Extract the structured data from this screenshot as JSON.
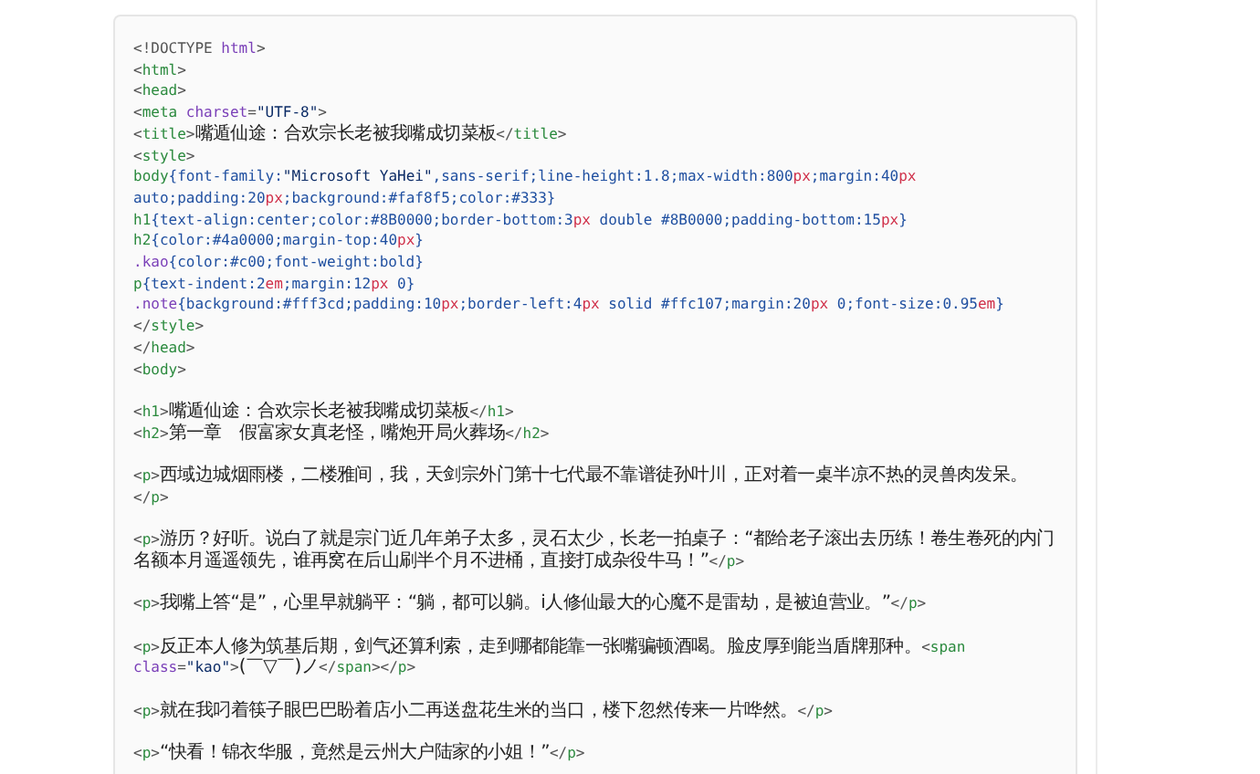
{
  "code_block": {
    "lines": [
      {
        "tokens": [
          {
            "kind": "p",
            "text": "<!DOCTYPE "
          },
          {
            "kind": "attr",
            "text": "html"
          },
          {
            "kind": "p",
            "text": ">"
          }
        ]
      },
      {
        "tokens": [
          {
            "kind": "p",
            "text": "<"
          },
          {
            "kind": "tag",
            "text": "html"
          },
          {
            "kind": "p",
            "text": ">"
          }
        ]
      },
      {
        "tokens": [
          {
            "kind": "p",
            "text": "<"
          },
          {
            "kind": "tag",
            "text": "head"
          },
          {
            "kind": "p",
            "text": ">"
          }
        ]
      },
      {
        "tokens": [
          {
            "kind": "p",
            "text": "<"
          },
          {
            "kind": "tag",
            "text": "meta"
          },
          {
            "kind": "attr",
            "text": " charset"
          },
          {
            "kind": "p",
            "text": "="
          },
          {
            "kind": "str",
            "text": "\"UTF-8\""
          },
          {
            "kind": "p",
            "text": ">"
          }
        ]
      },
      {
        "tokens": [
          {
            "kind": "p",
            "text": "<"
          },
          {
            "kind": "tag",
            "text": "title"
          },
          {
            "kind": "p",
            "text": ">"
          },
          {
            "kind": "cjk",
            "text": "嘴遁仙途：合欢宗长老被我嘴成切菜板"
          },
          {
            "kind": "p",
            "text": "</"
          },
          {
            "kind": "tag",
            "text": "title"
          },
          {
            "kind": "p",
            "text": ">"
          }
        ]
      },
      {
        "tokens": [
          {
            "kind": "p",
            "text": "<"
          },
          {
            "kind": "tag",
            "text": "style"
          },
          {
            "kind": "p",
            "text": ">"
          }
        ]
      },
      {
        "tokens": [
          {
            "kind": "sel",
            "text": "body"
          },
          {
            "kind": "prop",
            "text": "{font-family:"
          },
          {
            "kind": "str",
            "text": "\"Microsoft YaHei\""
          },
          {
            "kind": "prop",
            "text": ",sans-serif;line-height:"
          },
          {
            "kind": "num",
            "text": "1.8"
          },
          {
            "kind": "prop",
            "text": ";max-width:"
          },
          {
            "kind": "num",
            "text": "800"
          },
          {
            "kind": "unit",
            "text": "px"
          },
          {
            "kind": "prop",
            "text": ";margin:"
          },
          {
            "kind": "num",
            "text": "40"
          },
          {
            "kind": "unit",
            "text": "px"
          },
          {
            "kind": "prop",
            "text": " auto;padding:"
          },
          {
            "kind": "num",
            "text": "20"
          },
          {
            "kind": "unit",
            "text": "px"
          },
          {
            "kind": "prop",
            "text": ";background:#faf8f5;color:#333}"
          }
        ]
      },
      {
        "tokens": [
          {
            "kind": "sel",
            "text": "h1"
          },
          {
            "kind": "prop",
            "text": "{text-align:center;color:#8B0000;border-bottom:"
          },
          {
            "kind": "num",
            "text": "3"
          },
          {
            "kind": "unit",
            "text": "px"
          },
          {
            "kind": "prop",
            "text": " double #8B0000;padding-bottom:"
          },
          {
            "kind": "num",
            "text": "15"
          },
          {
            "kind": "unit",
            "text": "px"
          },
          {
            "kind": "prop",
            "text": "}"
          }
        ]
      },
      {
        "tokens": [
          {
            "kind": "sel",
            "text": "h2"
          },
          {
            "kind": "prop",
            "text": "{color:#4a0000;margin-top:"
          },
          {
            "kind": "num",
            "text": "40"
          },
          {
            "kind": "unit",
            "text": "px"
          },
          {
            "kind": "prop",
            "text": "}"
          }
        ]
      },
      {
        "tokens": [
          {
            "kind": "cls",
            "text": ".kao"
          },
          {
            "kind": "prop",
            "text": "{color:#c00;font-weight:bold}"
          }
        ]
      },
      {
        "tokens": [
          {
            "kind": "sel",
            "text": "p"
          },
          {
            "kind": "prop",
            "text": "{text-indent:"
          },
          {
            "kind": "num",
            "text": "2"
          },
          {
            "kind": "unit",
            "text": "em"
          },
          {
            "kind": "prop",
            "text": ";margin:"
          },
          {
            "kind": "num",
            "text": "12"
          },
          {
            "kind": "unit",
            "text": "px"
          },
          {
            "kind": "prop",
            "text": " 0}"
          }
        ]
      },
      {
        "tokens": [
          {
            "kind": "cls",
            "text": ".note"
          },
          {
            "kind": "prop",
            "text": "{background:#fff3cd;padding:"
          },
          {
            "kind": "num",
            "text": "10"
          },
          {
            "kind": "unit",
            "text": "px"
          },
          {
            "kind": "prop",
            "text": ";border-left:"
          },
          {
            "kind": "num",
            "text": "4"
          },
          {
            "kind": "unit",
            "text": "px"
          },
          {
            "kind": "prop",
            "text": " solid #ffc107;margin:"
          },
          {
            "kind": "num",
            "text": "20"
          },
          {
            "kind": "unit",
            "text": "px"
          },
          {
            "kind": "prop",
            "text": " 0;font-size:"
          },
          {
            "kind": "num",
            "text": "0.95"
          },
          {
            "kind": "unit",
            "text": "em"
          },
          {
            "kind": "prop",
            "text": "}"
          }
        ]
      },
      {
        "tokens": [
          {
            "kind": "p",
            "text": "</"
          },
          {
            "kind": "tag",
            "text": "style"
          },
          {
            "kind": "p",
            "text": ">"
          }
        ]
      },
      {
        "tokens": [
          {
            "kind": "p",
            "text": "</"
          },
          {
            "kind": "tag",
            "text": "head"
          },
          {
            "kind": "p",
            "text": ">"
          }
        ]
      },
      {
        "tokens": [
          {
            "kind": "p",
            "text": "<"
          },
          {
            "kind": "tag",
            "text": "body"
          },
          {
            "kind": "p",
            "text": ">"
          }
        ]
      },
      {
        "gap_before": true,
        "tokens": [
          {
            "kind": "p",
            "text": "<"
          },
          {
            "kind": "tag",
            "text": "h1"
          },
          {
            "kind": "p",
            "text": ">"
          },
          {
            "kind": "cjk",
            "text": "嘴遁仙途：合欢宗长老被我嘴成切菜板"
          },
          {
            "kind": "p",
            "text": "</"
          },
          {
            "kind": "tag",
            "text": "h1"
          },
          {
            "kind": "p",
            "text": ">"
          }
        ]
      },
      {
        "tokens": [
          {
            "kind": "p",
            "text": "<"
          },
          {
            "kind": "tag",
            "text": "h2"
          },
          {
            "kind": "p",
            "text": ">"
          },
          {
            "kind": "cjk",
            "text": "第一章　假富家女真老怪，嘴炮开局火葬场"
          },
          {
            "kind": "p",
            "text": "</"
          },
          {
            "kind": "tag",
            "text": "h2"
          },
          {
            "kind": "p",
            "text": ">"
          }
        ]
      },
      {
        "gap_before": true,
        "tokens": [
          {
            "kind": "p",
            "text": "<"
          },
          {
            "kind": "tag",
            "text": "p"
          },
          {
            "kind": "p",
            "text": ">"
          },
          {
            "kind": "cjk",
            "text": "西域边城烟雨楼，二楼雅间，我，天剑宗外门第十七代最不靠谱徒孙叶川，正对着一桌半凉不热的灵兽肉发呆。"
          },
          {
            "kind": "p",
            "text": "</"
          },
          {
            "kind": "tag",
            "text": "p"
          },
          {
            "kind": "p",
            "text": ">"
          }
        ]
      },
      {
        "gap_before": true,
        "tokens": [
          {
            "kind": "p",
            "text": "<"
          },
          {
            "kind": "tag",
            "text": "p"
          },
          {
            "kind": "p",
            "text": ">"
          },
          {
            "kind": "cjk",
            "text": "游历？好听。说白了就是宗门近几年弟子太多，灵石太少，长老一拍桌子：“都给老子滚出去历练！卷生卷死的内门名额本月遥遥领先，谁再窝在后山刷半个月不进桶，直接打成杂役牛马！”"
          },
          {
            "kind": "p",
            "text": "</"
          },
          {
            "kind": "tag",
            "text": "p"
          },
          {
            "kind": "p",
            "text": ">"
          }
        ]
      },
      {
        "gap_before": true,
        "tokens": [
          {
            "kind": "p",
            "text": "<"
          },
          {
            "kind": "tag",
            "text": "p"
          },
          {
            "kind": "p",
            "text": ">"
          },
          {
            "kind": "cjk",
            "text": "我嘴上答“是”，心里早就躺平：“躺，都可以躺。i人修仙最大的心魔不是雷劫，是被迫营业。”"
          },
          {
            "kind": "p",
            "text": "</"
          },
          {
            "kind": "tag",
            "text": "p"
          },
          {
            "kind": "p",
            "text": ">"
          }
        ]
      },
      {
        "gap_before": true,
        "tokens": [
          {
            "kind": "p",
            "text": "<"
          },
          {
            "kind": "tag",
            "text": "p"
          },
          {
            "kind": "p",
            "text": ">"
          },
          {
            "kind": "cjk",
            "text": "反正本人修为筑基后期，剑气还算利索，走到哪都能靠一张嘴骗顿酒喝。脸皮厚到能当盾牌那种。"
          },
          {
            "kind": "p",
            "text": "<"
          },
          {
            "kind": "tag",
            "text": "span"
          },
          {
            "kind": "attr",
            "text": " class"
          },
          {
            "kind": "p",
            "text": "="
          },
          {
            "kind": "str",
            "text": "\"kao\""
          },
          {
            "kind": "p",
            "text": ">"
          },
          {
            "kind": "cjk",
            "text": "(￣▽￣)ノ"
          },
          {
            "kind": "p",
            "text": "</"
          },
          {
            "kind": "tag",
            "text": "span"
          },
          {
            "kind": "p",
            "text": "></"
          },
          {
            "kind": "tag",
            "text": "p"
          },
          {
            "kind": "p",
            "text": ">"
          }
        ]
      },
      {
        "gap_before": true,
        "tokens": [
          {
            "kind": "p",
            "text": "<"
          },
          {
            "kind": "tag",
            "text": "p"
          },
          {
            "kind": "p",
            "text": ">"
          },
          {
            "kind": "cjk",
            "text": "就在我叼着筷子眼巴巴盼着店小二再送盘花生米的当口，楼下忽然传来一片哗然。"
          },
          {
            "kind": "p",
            "text": "</"
          },
          {
            "kind": "tag",
            "text": "p"
          },
          {
            "kind": "p",
            "text": ">"
          }
        ]
      },
      {
        "gap_before": true,
        "tokens": [
          {
            "kind": "p",
            "text": "<"
          },
          {
            "kind": "tag",
            "text": "p"
          },
          {
            "kind": "p",
            "text": ">"
          },
          {
            "kind": "cjk",
            "text": "“快看！锦衣华服，竟然是云州大户陆家的小姐！”"
          },
          {
            "kind": "p",
            "text": "</"
          },
          {
            "kind": "tag",
            "text": "p"
          },
          {
            "kind": "p",
            "text": ">"
          }
        ]
      }
    ]
  }
}
